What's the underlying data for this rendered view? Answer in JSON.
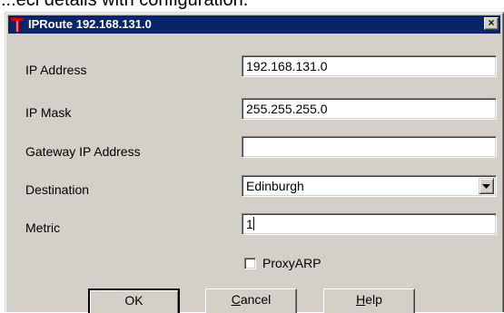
{
  "background_text": "...ecl details with configuration.",
  "window": {
    "title": "IPRoute 192.168.131.0",
    "close_glyph": "×"
  },
  "fields": {
    "ip_address": {
      "label": "IP Address",
      "value": "192.168.131.0"
    },
    "ip_mask": {
      "label": "IP Mask",
      "value": "255.255.255.0"
    },
    "gateway": {
      "label": "Gateway IP Address",
      "value": ""
    },
    "destination": {
      "label": "Destination",
      "value": "Edinburgh"
    },
    "metric": {
      "label": "Metric",
      "value": "1"
    }
  },
  "proxyarp": {
    "label": "ProxyARP",
    "checked": false
  },
  "buttons": {
    "ok": "OK",
    "cancel_first": "C",
    "cancel_rest": "ancel",
    "help_first": "H",
    "help_rest": "elp"
  },
  "colors": {
    "titlebar": "#0a246a",
    "dialog_face": "#d4d0c8",
    "app_icon_red": "#cc0000"
  }
}
